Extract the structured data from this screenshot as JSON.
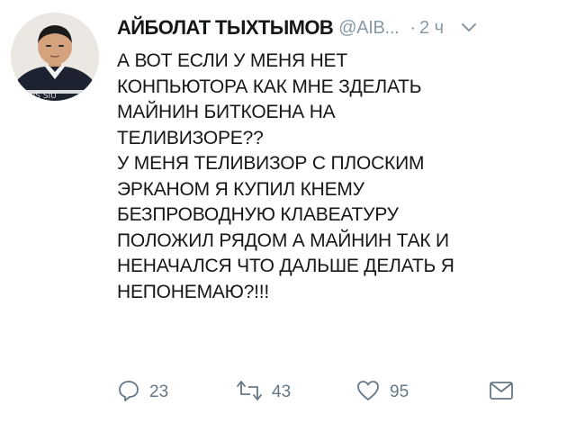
{
  "tweet": {
    "author": {
      "display_name": "АЙБОЛАТ ТЫХТЫМОВ",
      "handle": "@AIB...",
      "avatar": "avatar-photo"
    },
    "separator": "·",
    "timestamp": "2 ч",
    "lines": [
      "А ВОТ ЕСЛИ У МЕНЯ НЕТ",
      "КОНПЬЮТОРА КАК МНЕ ЗДЕЛАТЬ",
      "МАЙНИН БИТКОЕНА НА",
      "ТЕЛИВИЗОРЕ??",
      "У МЕНЯ ТЕЛИВИЗОР С ПЛОСКИМ",
      "ЭРКАНОМ Я КУПИЛ КНЕМУ",
      "БЕЗПРОВОДНУЮ КЛАВЕАТУРУ",
      "ПОЛОЖИЛ РЯДОМ А МАЙНИН ТАК И",
      "НЕНАЧАЛСЯ ЧТО ДАЛЬШЕ ДЕЛАТЬ Я",
      "НЕПОНЕМАЮ?!!!"
    ],
    "actions": {
      "reply": {
        "icon": "reply-icon",
        "count": "23"
      },
      "retweet": {
        "icon": "retweet-icon",
        "count": "43"
      },
      "like": {
        "icon": "heart-icon",
        "count": "95"
      },
      "dm": {
        "icon": "envelope-icon"
      }
    },
    "colors": {
      "text": "#14171a",
      "secondary": "#8899a6",
      "icon": "#657786"
    }
  }
}
